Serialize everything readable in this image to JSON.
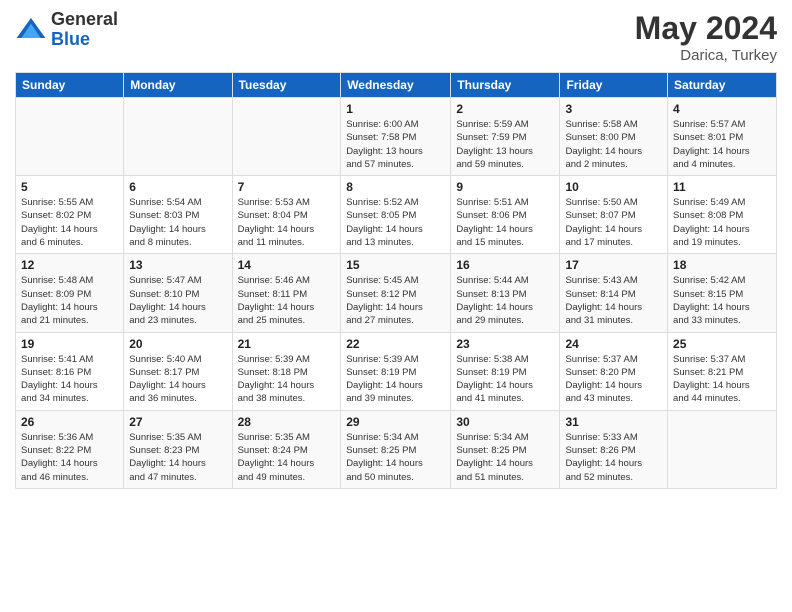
{
  "logo": {
    "general": "General",
    "blue": "Blue"
  },
  "title": {
    "month_year": "May 2024",
    "location": "Darica, Turkey"
  },
  "days_of_week": [
    "Sunday",
    "Monday",
    "Tuesday",
    "Wednesday",
    "Thursday",
    "Friday",
    "Saturday"
  ],
  "weeks": [
    [
      {
        "day": "",
        "info": ""
      },
      {
        "day": "",
        "info": ""
      },
      {
        "day": "",
        "info": ""
      },
      {
        "day": "1",
        "info": "Sunrise: 6:00 AM\nSunset: 7:58 PM\nDaylight: 13 hours\nand 57 minutes."
      },
      {
        "day": "2",
        "info": "Sunrise: 5:59 AM\nSunset: 7:59 PM\nDaylight: 13 hours\nand 59 minutes."
      },
      {
        "day": "3",
        "info": "Sunrise: 5:58 AM\nSunset: 8:00 PM\nDaylight: 14 hours\nand 2 minutes."
      },
      {
        "day": "4",
        "info": "Sunrise: 5:57 AM\nSunset: 8:01 PM\nDaylight: 14 hours\nand 4 minutes."
      }
    ],
    [
      {
        "day": "5",
        "info": "Sunrise: 5:55 AM\nSunset: 8:02 PM\nDaylight: 14 hours\nand 6 minutes."
      },
      {
        "day": "6",
        "info": "Sunrise: 5:54 AM\nSunset: 8:03 PM\nDaylight: 14 hours\nand 8 minutes."
      },
      {
        "day": "7",
        "info": "Sunrise: 5:53 AM\nSunset: 8:04 PM\nDaylight: 14 hours\nand 11 minutes."
      },
      {
        "day": "8",
        "info": "Sunrise: 5:52 AM\nSunset: 8:05 PM\nDaylight: 14 hours\nand 13 minutes."
      },
      {
        "day": "9",
        "info": "Sunrise: 5:51 AM\nSunset: 8:06 PM\nDaylight: 14 hours\nand 15 minutes."
      },
      {
        "day": "10",
        "info": "Sunrise: 5:50 AM\nSunset: 8:07 PM\nDaylight: 14 hours\nand 17 minutes."
      },
      {
        "day": "11",
        "info": "Sunrise: 5:49 AM\nSunset: 8:08 PM\nDaylight: 14 hours\nand 19 minutes."
      }
    ],
    [
      {
        "day": "12",
        "info": "Sunrise: 5:48 AM\nSunset: 8:09 PM\nDaylight: 14 hours\nand 21 minutes."
      },
      {
        "day": "13",
        "info": "Sunrise: 5:47 AM\nSunset: 8:10 PM\nDaylight: 14 hours\nand 23 minutes."
      },
      {
        "day": "14",
        "info": "Sunrise: 5:46 AM\nSunset: 8:11 PM\nDaylight: 14 hours\nand 25 minutes."
      },
      {
        "day": "15",
        "info": "Sunrise: 5:45 AM\nSunset: 8:12 PM\nDaylight: 14 hours\nand 27 minutes."
      },
      {
        "day": "16",
        "info": "Sunrise: 5:44 AM\nSunset: 8:13 PM\nDaylight: 14 hours\nand 29 minutes."
      },
      {
        "day": "17",
        "info": "Sunrise: 5:43 AM\nSunset: 8:14 PM\nDaylight: 14 hours\nand 31 minutes."
      },
      {
        "day": "18",
        "info": "Sunrise: 5:42 AM\nSunset: 8:15 PM\nDaylight: 14 hours\nand 33 minutes."
      }
    ],
    [
      {
        "day": "19",
        "info": "Sunrise: 5:41 AM\nSunset: 8:16 PM\nDaylight: 14 hours\nand 34 minutes."
      },
      {
        "day": "20",
        "info": "Sunrise: 5:40 AM\nSunset: 8:17 PM\nDaylight: 14 hours\nand 36 minutes."
      },
      {
        "day": "21",
        "info": "Sunrise: 5:39 AM\nSunset: 8:18 PM\nDaylight: 14 hours\nand 38 minutes."
      },
      {
        "day": "22",
        "info": "Sunrise: 5:39 AM\nSunset: 8:19 PM\nDaylight: 14 hours\nand 39 minutes."
      },
      {
        "day": "23",
        "info": "Sunrise: 5:38 AM\nSunset: 8:19 PM\nDaylight: 14 hours\nand 41 minutes."
      },
      {
        "day": "24",
        "info": "Sunrise: 5:37 AM\nSunset: 8:20 PM\nDaylight: 14 hours\nand 43 minutes."
      },
      {
        "day": "25",
        "info": "Sunrise: 5:37 AM\nSunset: 8:21 PM\nDaylight: 14 hours\nand 44 minutes."
      }
    ],
    [
      {
        "day": "26",
        "info": "Sunrise: 5:36 AM\nSunset: 8:22 PM\nDaylight: 14 hours\nand 46 minutes."
      },
      {
        "day": "27",
        "info": "Sunrise: 5:35 AM\nSunset: 8:23 PM\nDaylight: 14 hours\nand 47 minutes."
      },
      {
        "day": "28",
        "info": "Sunrise: 5:35 AM\nSunset: 8:24 PM\nDaylight: 14 hours\nand 49 minutes."
      },
      {
        "day": "29",
        "info": "Sunrise: 5:34 AM\nSunset: 8:25 PM\nDaylight: 14 hours\nand 50 minutes."
      },
      {
        "day": "30",
        "info": "Sunrise: 5:34 AM\nSunset: 8:25 PM\nDaylight: 14 hours\nand 51 minutes."
      },
      {
        "day": "31",
        "info": "Sunrise: 5:33 AM\nSunset: 8:26 PM\nDaylight: 14 hours\nand 52 minutes."
      },
      {
        "day": "",
        "info": ""
      }
    ]
  ]
}
